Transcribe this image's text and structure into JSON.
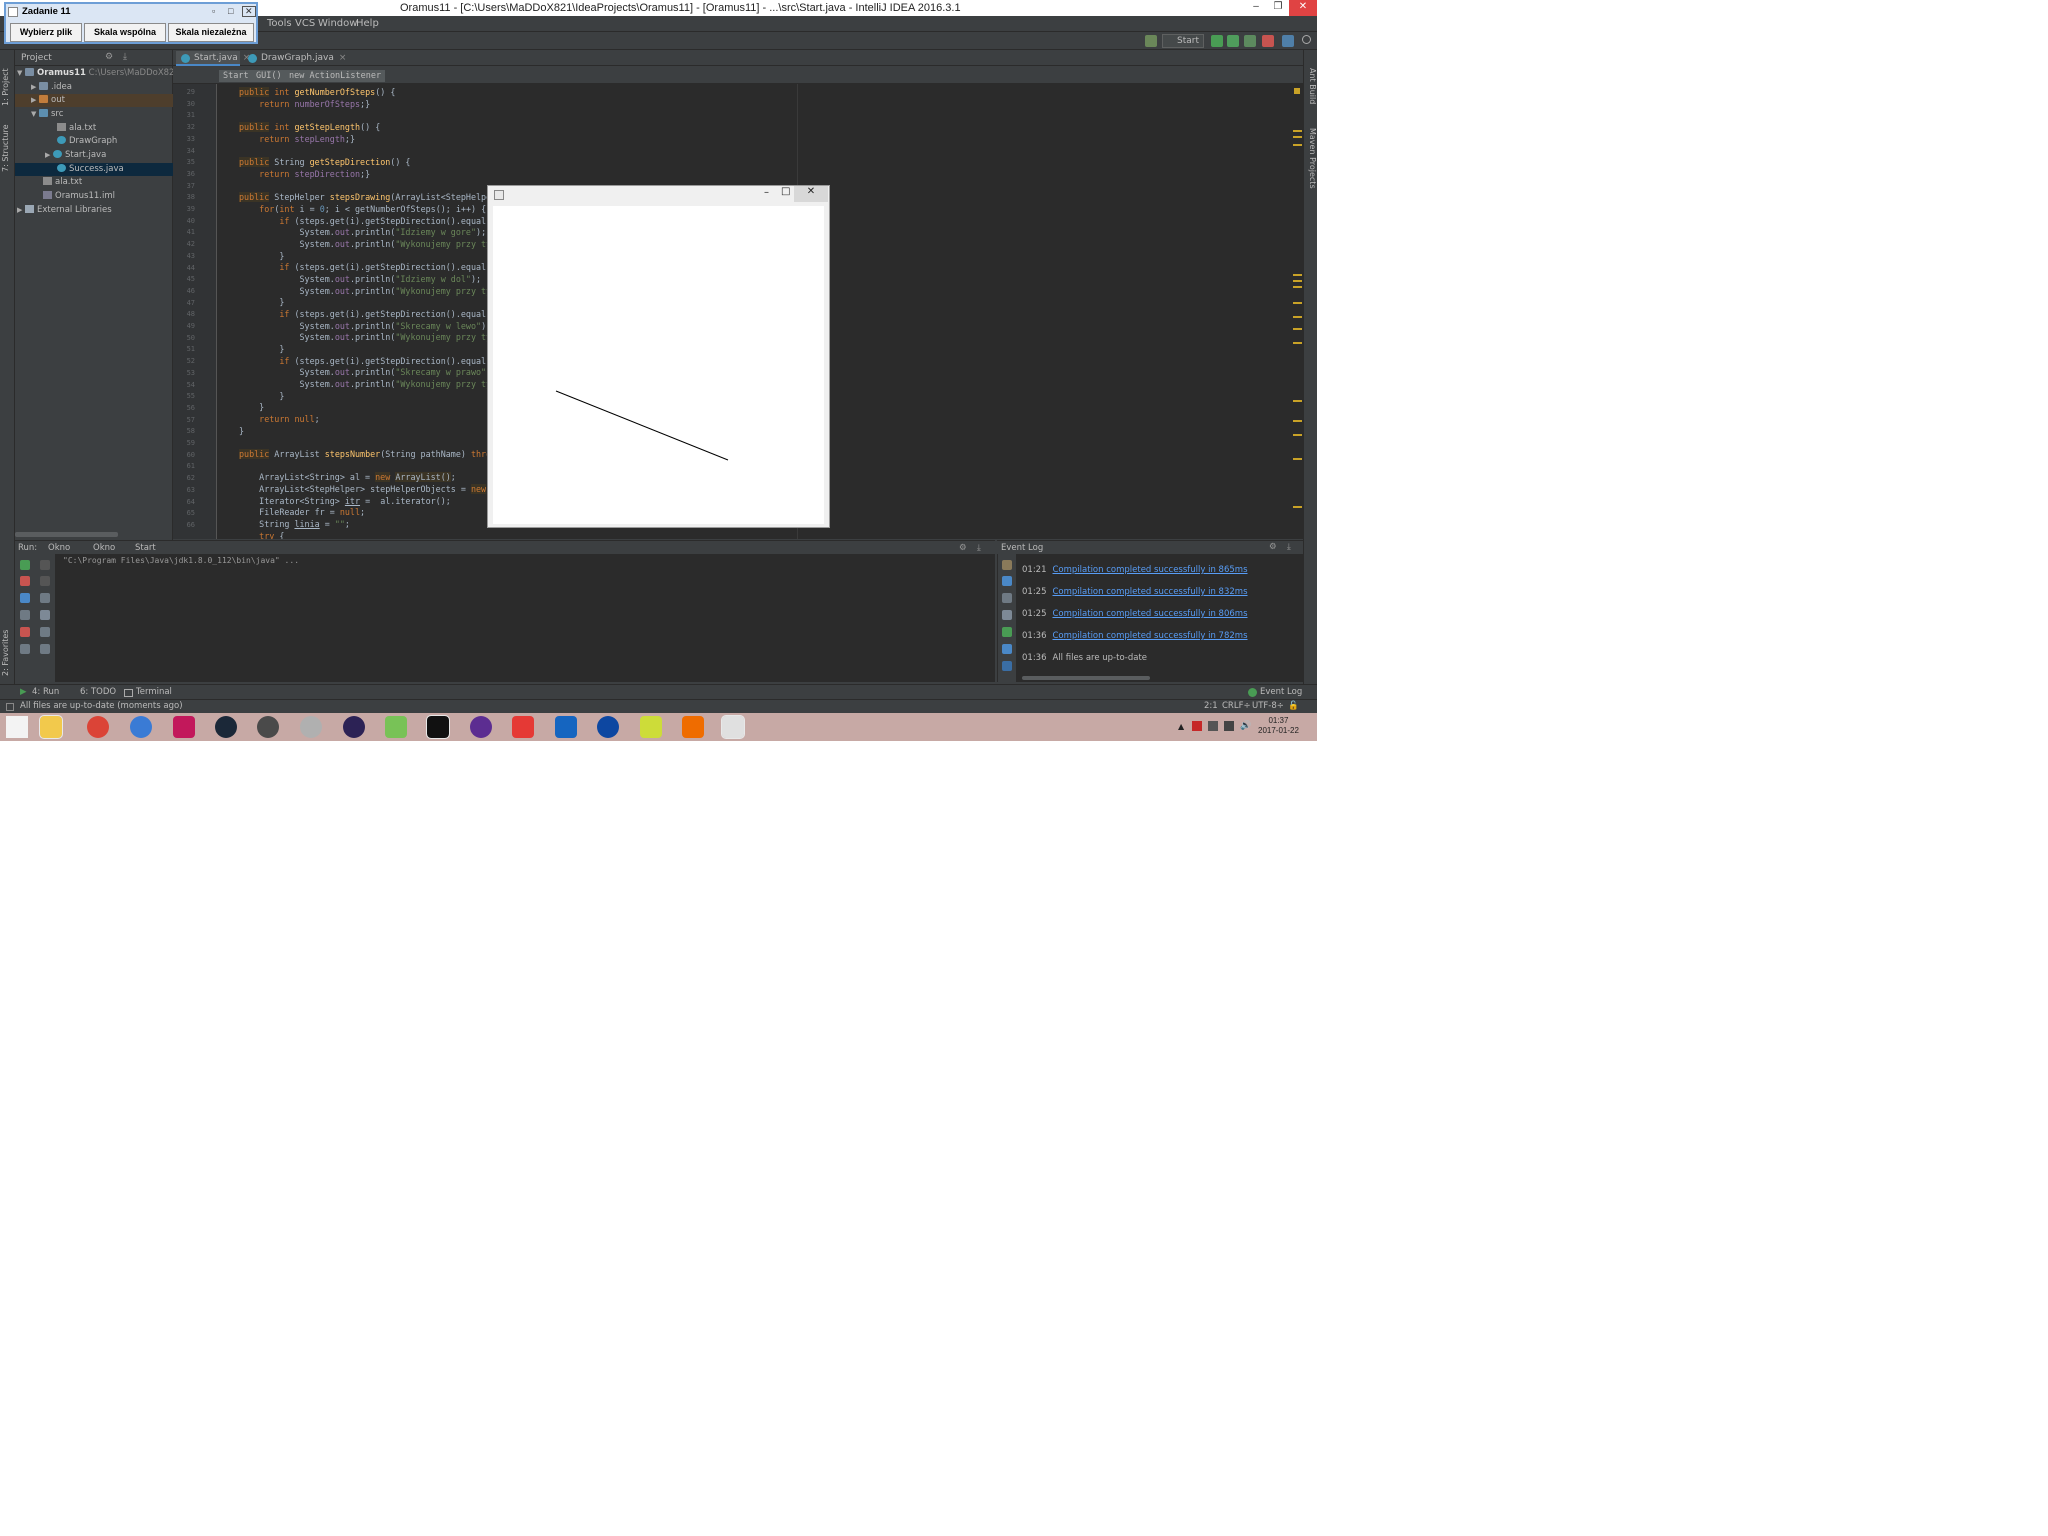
{
  "window": {
    "title": "Oramus11 - [C:\\Users\\MaDDoX821\\IdeaProjects\\Oramus11] - [Oramus11] - ...\\src\\Start.java - IntelliJ IDEA 2016.3.1",
    "minimize": "‒",
    "maximize": "❐",
    "close": "✕"
  },
  "menu": [
    "Tools",
    "VCS",
    "Window",
    "Help"
  ],
  "toolbar": {
    "run_config": "Start"
  },
  "left_strip": {
    "project": "1: Project",
    "structure": "7: Structure",
    "favorites": "2: Favorites"
  },
  "right_strip": {
    "ant": "Ant Build",
    "maven": "Maven Projects"
  },
  "project_panel": {
    "header": "Project",
    "tree": [
      {
        "label": "Oramus11",
        "extra": "C:\\Users\\MaDDoX821\\Ic"
      },
      {
        "label": ".idea"
      },
      {
        "label": "out"
      },
      {
        "label": "src"
      },
      {
        "label": "ala.txt"
      },
      {
        "label": "DrawGraph"
      },
      {
        "label": "Start.java"
      },
      {
        "label": "Success.java"
      },
      {
        "label": "ala.txt"
      },
      {
        "label": "Oramus11.iml"
      },
      {
        "label": "External Libraries"
      }
    ]
  },
  "tabs": [
    {
      "label": "Start.java",
      "close": "×"
    },
    {
      "label": "DrawGraph.java",
      "close": "×"
    }
  ],
  "breadcrumb": [
    "Start",
    "GUI()",
    "new ActionListener"
  ],
  "editor": {
    "line_numbers": [
      "29",
      "30",
      "31",
      "32",
      "33",
      "34",
      "35",
      "36",
      "37",
      "38",
      "39",
      "40",
      "41",
      "42",
      "43",
      "44",
      "45",
      "46",
      "47",
      "48",
      "49",
      "50",
      "51",
      "52",
      "53",
      "54",
      "55",
      "56",
      "57",
      "58",
      "59",
      "60",
      "61",
      "62",
      "63",
      "64",
      "65",
      "66"
    ]
  },
  "zadanie": {
    "title": "Zadanie 11",
    "buttons": [
      "Wybierz plik",
      "Skala wspólna",
      "Skala niezależna"
    ]
  },
  "run_panel": {
    "label": "Run:",
    "tabs": [
      "Okno",
      "Okno",
      "Start"
    ],
    "output": "\"C:\\Program Files\\Java\\jdk1.8.0_112\\bin\\java\" ..."
  },
  "event_log": {
    "title": "Event Log",
    "entries": [
      {
        "time": "01:21",
        "text": "Compilation completed successfully in 865ms",
        "link": true
      },
      {
        "time": "01:25",
        "text": "Compilation completed successfully in 832ms",
        "link": true
      },
      {
        "time": "01:25",
        "text": "Compilation completed successfully in 806ms",
        "link": true
      },
      {
        "time": "01:36",
        "text": "Compilation completed successfully in 782ms",
        "link": true
      },
      {
        "time": "01:36",
        "text": "All files are up-to-date",
        "link": false
      }
    ]
  },
  "bottom_tabs": [
    "4: Run",
    "6: TODO",
    "Terminal",
    "Event Log"
  ],
  "status": {
    "message": "All files are up-to-date (moments ago)",
    "position": "2:1",
    "line_sep": "CRLF÷",
    "encoding": "UTF-8÷"
  },
  "taskbar": {
    "time": "01:37",
    "date": "2017-01-22"
  }
}
